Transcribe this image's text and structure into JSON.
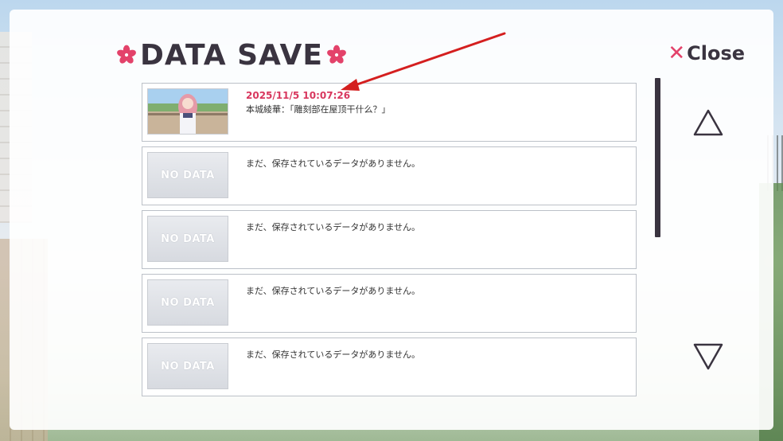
{
  "header": {
    "title": "DATA SAVE",
    "close_label": "Close",
    "close_symbol": "✕"
  },
  "slots": [
    {
      "type": "filled",
      "date": "2025/11/5 10:07:26",
      "text": "本城綾華：「雕刻部在屋顶干什么？」"
    },
    {
      "type": "empty",
      "thumb_label": "NO DATA",
      "text": "まだ、保存されているデータがありません。"
    },
    {
      "type": "empty",
      "thumb_label": "NO DATA",
      "text": "まだ、保存されているデータがありません。"
    },
    {
      "type": "empty",
      "thumb_label": "NO DATA",
      "text": "まだ、保存されているデータがありません。"
    },
    {
      "type": "empty",
      "thumb_label": "NO DATA",
      "text": "まだ、保存されているデータがありません。"
    }
  ],
  "icons": {
    "flower": "sakura-flower-icon",
    "scroll_up": "triangle-up-icon",
    "scroll_down": "triangle-down-icon",
    "annotation": "red-arrow-icon"
  },
  "colors": {
    "accent": "#e3426a",
    "date": "#d8375e",
    "title": "#3a3440",
    "annotation": "#d41f1f"
  }
}
